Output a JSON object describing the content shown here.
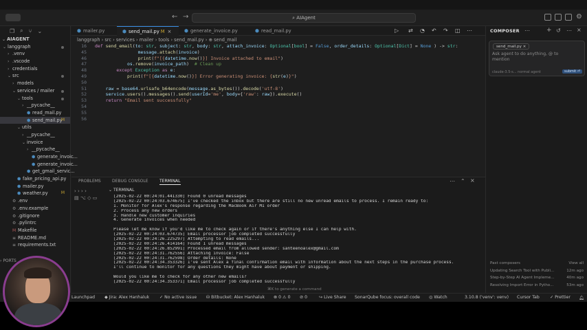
{
  "titlebar": {
    "search_text": "AIAgent"
  },
  "explorer": {
    "root": "AIAGENT",
    "items": [
      {
        "label": "langgraph",
        "depth": 0,
        "type": "folder-open",
        "status": "dot"
      },
      {
        "label": ".venv",
        "depth": 1,
        "type": "folder",
        "status": ""
      },
      {
        "label": ".vscode",
        "depth": 1,
        "type": "folder",
        "status": ""
      },
      {
        "label": "credentials",
        "depth": 1,
        "type": "folder",
        "status": ""
      },
      {
        "label": "src",
        "depth": 1,
        "type": "folder-open",
        "status": "dot"
      },
      {
        "label": "models",
        "depth": 2,
        "type": "folder",
        "status": ""
      },
      {
        "label": "services / mailer",
        "depth": 2,
        "type": "folder-open",
        "status": "dot"
      },
      {
        "label": "tools",
        "depth": 3,
        "type": "folder-open",
        "status": "dot"
      },
      {
        "label": "__pycache__",
        "depth": 4,
        "type": "folder",
        "status": ""
      },
      {
        "label": "read_mail.py",
        "depth": 4,
        "type": "py",
        "status": ""
      },
      {
        "label": "send_mail.py",
        "depth": 4,
        "type": "py",
        "status": "M"
      },
      {
        "label": "utils",
        "depth": 3,
        "type": "folder-open",
        "status": ""
      },
      {
        "label": "__pycache__",
        "depth": 4,
        "type": "folder",
        "status": ""
      },
      {
        "label": "invoice",
        "depth": 4,
        "type": "folder-open",
        "status": ""
      },
      {
        "label": "__pycache__",
        "depth": 5,
        "type": "folder",
        "status": ""
      },
      {
        "label": "generate_invoic...",
        "depth": 5,
        "type": "py",
        "status": ""
      },
      {
        "label": "generate_invoic...",
        "depth": 5,
        "type": "py",
        "status": ""
      },
      {
        "label": "get_gmail_servic...",
        "depth": 4,
        "type": "py",
        "status": ""
      },
      {
        "label": "fake_pricing_api.py",
        "depth": 2,
        "type": "py",
        "status": ""
      },
      {
        "label": "mailer.py",
        "depth": 2,
        "type": "py",
        "status": ""
      },
      {
        "label": "weather.py",
        "depth": 2,
        "type": "py",
        "status": "M"
      },
      {
        "label": ".env",
        "depth": 1,
        "type": "gear",
        "status": ""
      },
      {
        "label": ".env.example",
        "depth": 1,
        "type": "gear",
        "status": ""
      },
      {
        "label": ".gitignore",
        "depth": 1,
        "type": "gear",
        "status": ""
      },
      {
        "label": ".pylintrc",
        "depth": 1,
        "type": "gear",
        "status": ""
      },
      {
        "label": "Makefile",
        "depth": 1,
        "type": "mk",
        "status": ""
      },
      {
        "label": "README.md",
        "depth": 1,
        "type": "txt",
        "status": ""
      },
      {
        "label": "requirements.txt",
        "depth": 1,
        "type": "txt",
        "status": ""
      }
    ],
    "ports_label": "PORTS"
  },
  "tabs": [
    {
      "label": "mailer.py",
      "active": false,
      "modified": false
    },
    {
      "label": "send_mail.py",
      "active": true,
      "modified": true
    },
    {
      "label": "generate_invoice.py",
      "active": false,
      "modified": false
    },
    {
      "label": "read_mail.py",
      "active": false,
      "modified": false
    }
  ],
  "breadcrumb": "langgraph › src › services › mailer › tools › send_mail.py › ⊕ send_mail",
  "code": [
    {
      "n": "16",
      "html_tokens": [
        [
          "kw",
          "def "
        ],
        [
          "fn",
          "send_email"
        ],
        [
          "",
          "("
        ],
        [
          "vr",
          "to"
        ],
        [
          "",
          ": "
        ],
        [
          "ty",
          "str"
        ],
        [
          "",
          ", "
        ],
        [
          "vr",
          "subject"
        ],
        [
          "",
          ": "
        ],
        [
          "ty",
          "str"
        ],
        [
          "",
          ", "
        ],
        [
          "vr",
          "body"
        ],
        [
          "",
          ": "
        ],
        [
          "ty",
          "str"
        ],
        [
          "",
          ", "
        ],
        [
          "vr",
          "attach_invoice"
        ],
        [
          "",
          ": "
        ],
        [
          "ty",
          "Optional"
        ],
        [
          "",
          "["
        ],
        [
          "ty",
          "bool"
        ],
        [
          "",
          "] = "
        ],
        [
          "bl",
          "False"
        ],
        [
          "",
          ", "
        ],
        [
          "vr",
          "order_details"
        ],
        [
          "",
          ": "
        ],
        [
          "ty",
          "Optional"
        ],
        [
          "",
          "["
        ],
        [
          "ty",
          "Dict"
        ],
        [
          "",
          "] = "
        ],
        [
          "bl",
          "None"
        ],
        [
          "",
          " ) -> "
        ],
        [
          "ty",
          "str"
        ],
        [
          "",
          ":"
        ]
      ]
    },
    {
      "n": "45",
      "html_tokens": [
        [
          "",
          "                "
        ],
        [
          "vr",
          "message"
        ],
        [
          "",
          "."
        ],
        [
          "fn",
          "attach"
        ],
        [
          "",
          "("
        ],
        [
          "vr",
          "invoice"
        ],
        [
          "",
          ")"
        ]
      ]
    },
    {
      "n": "46",
      "html_tokens": [
        [
          "",
          "                "
        ],
        [
          "fn",
          "print"
        ],
        [
          "",
          "("
        ],
        [
          "st",
          "f\"[{"
        ],
        [
          "vr",
          "datetime"
        ],
        [
          "",
          "."
        ],
        [
          "fn",
          "now"
        ],
        [
          "",
          "()"
        ],
        [
          "st",
          "}] Invoice attached to email\""
        ],
        [
          "",
          ")"
        ]
      ]
    },
    {
      "n": "47",
      "html_tokens": [
        [
          "",
          "            "
        ],
        [
          "vr",
          "os"
        ],
        [
          "",
          "."
        ],
        [
          "fn",
          "remove"
        ],
        [
          "",
          "("
        ],
        [
          "vr",
          "invoice_path"
        ],
        [
          "",
          ")  "
        ],
        [
          "cm",
          "# Clean up"
        ]
      ]
    },
    {
      "n": "48",
      "html_tokens": [
        [
          "",
          "        "
        ],
        [
          "kw",
          "except "
        ],
        [
          "ty",
          "Exception "
        ],
        [
          "kw",
          "as "
        ],
        [
          "vr",
          "e"
        ],
        [
          "",
          ":"
        ]
      ]
    },
    {
      "n": "49",
      "html_tokens": [
        [
          "",
          "            "
        ],
        [
          "fn",
          "print"
        ],
        [
          "",
          "("
        ],
        [
          "st",
          "f\"[{"
        ],
        [
          "vr",
          "datetime"
        ],
        [
          "",
          "."
        ],
        [
          "fn",
          "now"
        ],
        [
          "",
          "()"
        ],
        [
          "st",
          "}] Error generating invoice: {"
        ],
        [
          "fn",
          "str"
        ],
        [
          "",
          "("
        ],
        [
          "vr",
          "e"
        ],
        [
          "",
          ")"
        ],
        [
          "st",
          "}\""
        ],
        [
          "",
          ")"
        ]
      ]
    },
    {
      "n": "50",
      "html_tokens": []
    },
    {
      "n": "51",
      "html_tokens": [
        [
          "",
          "    "
        ],
        [
          "vr",
          "raw"
        ],
        [
          "",
          " = "
        ],
        [
          "vr",
          "base64"
        ],
        [
          "",
          "."
        ],
        [
          "fn",
          "urlsafe_b64encode"
        ],
        [
          "",
          "("
        ],
        [
          "vr",
          "message"
        ],
        [
          "",
          "."
        ],
        [
          "fn",
          "as_bytes"
        ],
        [
          "",
          "())."
        ],
        [
          "fn",
          "decode"
        ],
        [
          "",
          "("
        ],
        [
          "st",
          "'utf-8'"
        ],
        [
          "",
          ")"
        ]
      ]
    },
    {
      "n": "52",
      "html_tokens": [
        [
          "",
          "    "
        ],
        [
          "vr",
          "service"
        ],
        [
          "",
          "."
        ],
        [
          "fn",
          "users"
        ],
        [
          "",
          "()."
        ],
        [
          "fn",
          "messages"
        ],
        [
          "",
          "()."
        ],
        [
          "fn",
          "send"
        ],
        [
          "",
          "("
        ],
        [
          "vr",
          "userId"
        ],
        [
          "",
          "="
        ],
        [
          "st",
          "'me'"
        ],
        [
          "",
          ", "
        ],
        [
          "vr",
          "body"
        ],
        [
          "",
          "={"
        ],
        [
          "st",
          "'raw'"
        ],
        [
          "",
          ": "
        ],
        [
          "vr",
          "raw"
        ],
        [
          "",
          "})."
        ],
        [
          "fn",
          "execute"
        ],
        [
          "",
          "()"
        ]
      ]
    },
    {
      "n": "53",
      "html_tokens": [
        [
          "",
          "    "
        ],
        [
          "kw",
          "return "
        ],
        [
          "st",
          "\"Email sent successfully\""
        ]
      ]
    },
    {
      "n": "54",
      "html_tokens": []
    },
    {
      "n": "55",
      "html_tokens": []
    },
    {
      "n": "56",
      "html_tokens": []
    }
  ],
  "panel": {
    "tabs": [
      "PROBLEMS",
      "DEBUG CONSOLE",
      "TERMINAL"
    ],
    "active_tab": "TERMINAL",
    "terminal_header": "TERMINAL",
    "lines": [
      "[2025-02-22 00:24:01.441330] Found 0 unread messages",
      "[2025-02-22 00:24:03.674675] I've checked the inbox but there are still no new unread emails to process. I remain ready to:",
      "1. Monitor for Alex's response regarding the MacBook Air M1 order",
      "2. Process any new orders",
      "3. Handle new customer inquiries",
      "4. Generate invoices when needed",
      "",
      "Please let me know if you'd like me to check again or if there's anything else I can help with.",
      "[2025-02-22 00:24:03.674735] Email processor job completed successfully",
      "[2025-02-22 00:24:26.225297] Attempting to read emails...",
      "[2025-02-22 00:24:26.414164] Found 1 unread messages",
      "[2025-02-22 00:24:26.852991] Processed email from allowed sender: santeenoalex@gmail.com",
      "[2025-02-22 00:24:31.762556] Attaching invoice: False",
      "[2025-02-22 00:24:31.762598] Order details: None",
      "[2025-02-22 00:24:34.353326] I've sent Alex a final confirmation email with information about the next steps in the purchase process.",
      "I'll continue to monitor for any questions they might have about payment or shipping.",
      "",
      "Would you like me to check for any other new emails?",
      "[2025-02-22 00:24:34.353371] Email processor job completed successfully"
    ],
    "hint": "⌘K to generate a command"
  },
  "composer": {
    "title": "COMPOSER",
    "chip": "send_mail.py ×",
    "placeholder": "Ask agent to do anything, @ to mention",
    "footer": "claude-3.5-s...   normal   agent",
    "submit": "submit ⏎",
    "past_label": "Past composers",
    "view_all": "View all",
    "past": [
      {
        "title": "Updating Search Tool with Publi...",
        "age": "12m ago"
      },
      {
        "title": "Step-by-Step AI Agent Impleme...",
        "age": "40m ago"
      },
      {
        "title": "Resolving Import Error in Pytho...",
        "age": "53m ago"
      }
    ]
  },
  "statusbar": {
    "launchpad": "Launchpad",
    "jira": "Jira: Alex Hanhaluk",
    "issue": "No active issue",
    "bitbucket": "Bitbucket: Alex Hanhaluk",
    "problems": "⊗ 0 ⚠ 0",
    "ports": "⊘ 0",
    "live_share": "Live Share",
    "sonar": "SonarQube focus: overall code",
    "watch": "Watch",
    "python": "3.10.8 ('venv': venv)",
    "cursor_tab": "Cursor Tab",
    "prettier": "✓ Prettier"
  },
  "colors": {
    "accent": "#3a8ee6",
    "modified": "#c5a332",
    "webcam_ring": "#8a3d8f"
  }
}
